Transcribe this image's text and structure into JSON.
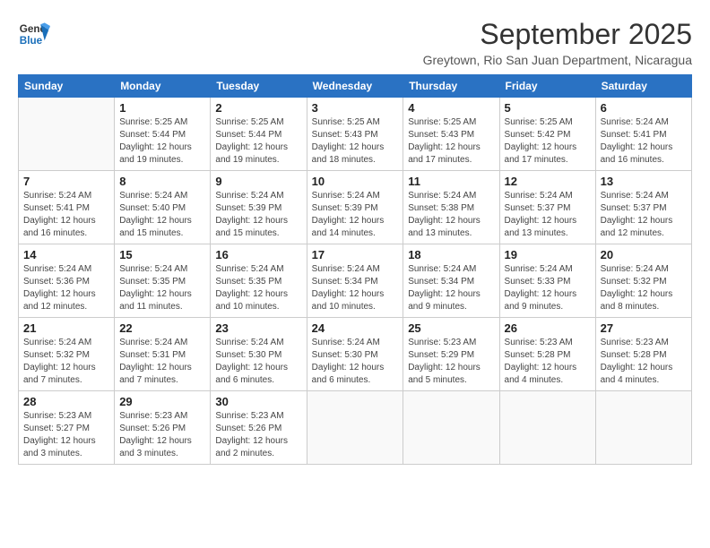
{
  "logo": {
    "line1": "General",
    "line2": "Blue"
  },
  "title": "September 2025",
  "subtitle": "Greytown, Rio San Juan Department, Nicaragua",
  "headers": [
    "Sunday",
    "Monday",
    "Tuesday",
    "Wednesday",
    "Thursday",
    "Friday",
    "Saturday"
  ],
  "weeks": [
    [
      {
        "day": "",
        "info": ""
      },
      {
        "day": "1",
        "info": "Sunrise: 5:25 AM\nSunset: 5:44 PM\nDaylight: 12 hours\nand 19 minutes."
      },
      {
        "day": "2",
        "info": "Sunrise: 5:25 AM\nSunset: 5:44 PM\nDaylight: 12 hours\nand 19 minutes."
      },
      {
        "day": "3",
        "info": "Sunrise: 5:25 AM\nSunset: 5:43 PM\nDaylight: 12 hours\nand 18 minutes."
      },
      {
        "day": "4",
        "info": "Sunrise: 5:25 AM\nSunset: 5:43 PM\nDaylight: 12 hours\nand 17 minutes."
      },
      {
        "day": "5",
        "info": "Sunrise: 5:25 AM\nSunset: 5:42 PM\nDaylight: 12 hours\nand 17 minutes."
      },
      {
        "day": "6",
        "info": "Sunrise: 5:24 AM\nSunset: 5:41 PM\nDaylight: 12 hours\nand 16 minutes."
      }
    ],
    [
      {
        "day": "7",
        "info": "Sunrise: 5:24 AM\nSunset: 5:41 PM\nDaylight: 12 hours\nand 16 minutes."
      },
      {
        "day": "8",
        "info": "Sunrise: 5:24 AM\nSunset: 5:40 PM\nDaylight: 12 hours\nand 15 minutes."
      },
      {
        "day": "9",
        "info": "Sunrise: 5:24 AM\nSunset: 5:39 PM\nDaylight: 12 hours\nand 15 minutes."
      },
      {
        "day": "10",
        "info": "Sunrise: 5:24 AM\nSunset: 5:39 PM\nDaylight: 12 hours\nand 14 minutes."
      },
      {
        "day": "11",
        "info": "Sunrise: 5:24 AM\nSunset: 5:38 PM\nDaylight: 12 hours\nand 13 minutes."
      },
      {
        "day": "12",
        "info": "Sunrise: 5:24 AM\nSunset: 5:37 PM\nDaylight: 12 hours\nand 13 minutes."
      },
      {
        "day": "13",
        "info": "Sunrise: 5:24 AM\nSunset: 5:37 PM\nDaylight: 12 hours\nand 12 minutes."
      }
    ],
    [
      {
        "day": "14",
        "info": "Sunrise: 5:24 AM\nSunset: 5:36 PM\nDaylight: 12 hours\nand 12 minutes."
      },
      {
        "day": "15",
        "info": "Sunrise: 5:24 AM\nSunset: 5:35 PM\nDaylight: 12 hours\nand 11 minutes."
      },
      {
        "day": "16",
        "info": "Sunrise: 5:24 AM\nSunset: 5:35 PM\nDaylight: 12 hours\nand 10 minutes."
      },
      {
        "day": "17",
        "info": "Sunrise: 5:24 AM\nSunset: 5:34 PM\nDaylight: 12 hours\nand 10 minutes."
      },
      {
        "day": "18",
        "info": "Sunrise: 5:24 AM\nSunset: 5:34 PM\nDaylight: 12 hours\nand 9 minutes."
      },
      {
        "day": "19",
        "info": "Sunrise: 5:24 AM\nSunset: 5:33 PM\nDaylight: 12 hours\nand 9 minutes."
      },
      {
        "day": "20",
        "info": "Sunrise: 5:24 AM\nSunset: 5:32 PM\nDaylight: 12 hours\nand 8 minutes."
      }
    ],
    [
      {
        "day": "21",
        "info": "Sunrise: 5:24 AM\nSunset: 5:32 PM\nDaylight: 12 hours\nand 7 minutes."
      },
      {
        "day": "22",
        "info": "Sunrise: 5:24 AM\nSunset: 5:31 PM\nDaylight: 12 hours\nand 7 minutes."
      },
      {
        "day": "23",
        "info": "Sunrise: 5:24 AM\nSunset: 5:30 PM\nDaylight: 12 hours\nand 6 minutes."
      },
      {
        "day": "24",
        "info": "Sunrise: 5:24 AM\nSunset: 5:30 PM\nDaylight: 12 hours\nand 6 minutes."
      },
      {
        "day": "25",
        "info": "Sunrise: 5:23 AM\nSunset: 5:29 PM\nDaylight: 12 hours\nand 5 minutes."
      },
      {
        "day": "26",
        "info": "Sunrise: 5:23 AM\nSunset: 5:28 PM\nDaylight: 12 hours\nand 4 minutes."
      },
      {
        "day": "27",
        "info": "Sunrise: 5:23 AM\nSunset: 5:28 PM\nDaylight: 12 hours\nand 4 minutes."
      }
    ],
    [
      {
        "day": "28",
        "info": "Sunrise: 5:23 AM\nSunset: 5:27 PM\nDaylight: 12 hours\nand 3 minutes."
      },
      {
        "day": "29",
        "info": "Sunrise: 5:23 AM\nSunset: 5:26 PM\nDaylight: 12 hours\nand 3 minutes."
      },
      {
        "day": "30",
        "info": "Sunrise: 5:23 AM\nSunset: 5:26 PM\nDaylight: 12 hours\nand 2 minutes."
      },
      {
        "day": "",
        "info": ""
      },
      {
        "day": "",
        "info": ""
      },
      {
        "day": "",
        "info": ""
      },
      {
        "day": "",
        "info": ""
      }
    ]
  ]
}
